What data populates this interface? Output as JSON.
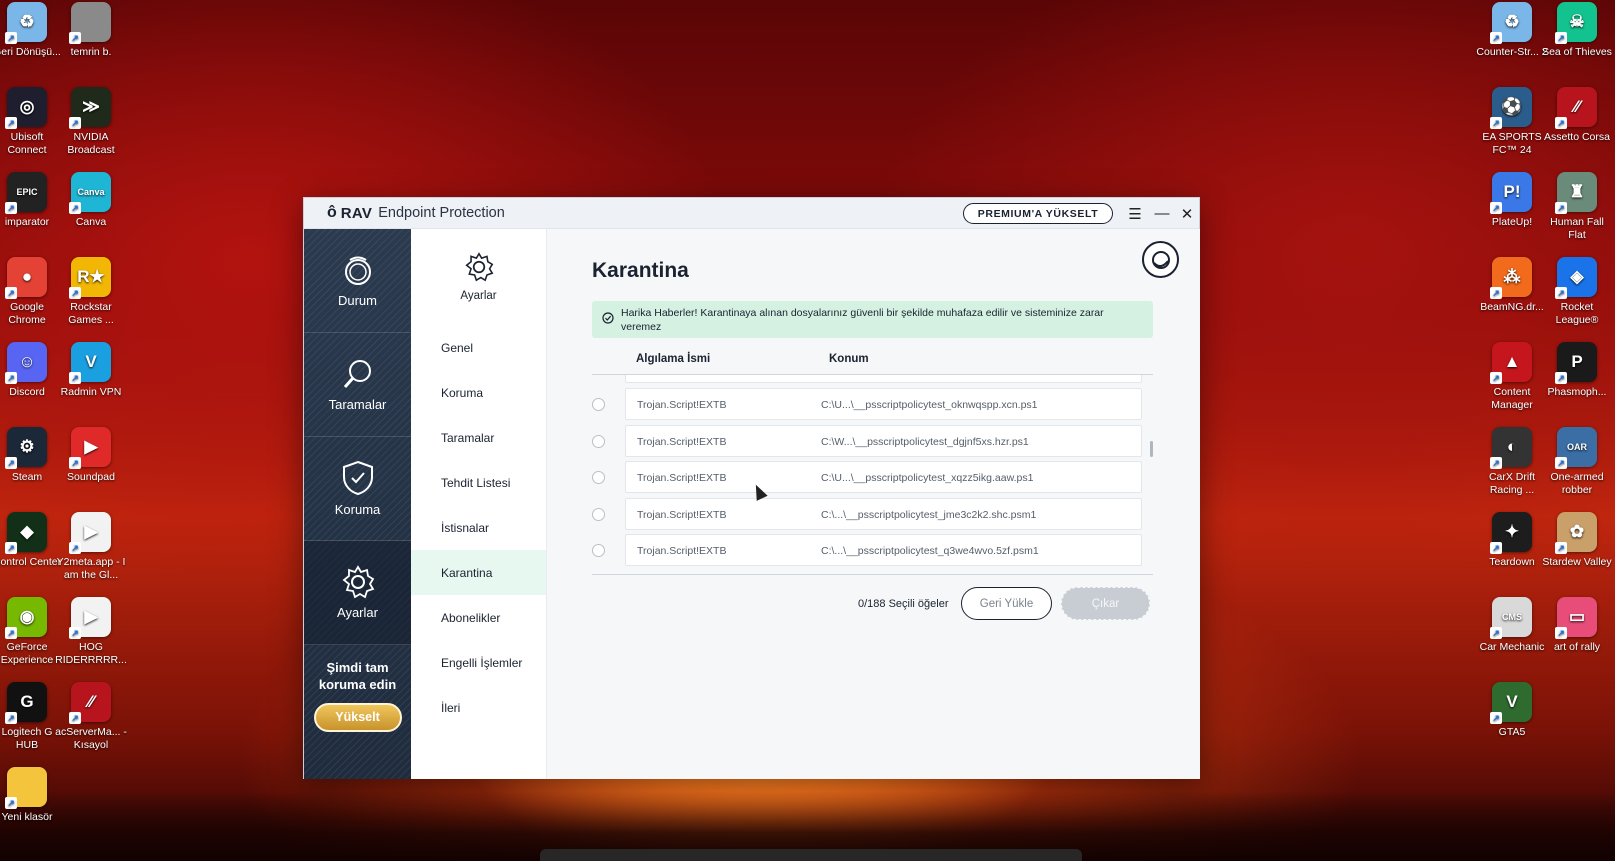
{
  "desktop": {
    "left_icons": [
      {
        "label": "Geri Dönüşü...",
        "icon": "recycle-bin-icon",
        "color": "#7bb6e8",
        "glyph": "♻"
      },
      {
        "label": "temrin b.",
        "icon": "file-icon",
        "color": "#8a8a8a",
        "glyph": ""
      },
      {
        "label": "Ubisoft Connect",
        "icon": "ubisoft-icon",
        "color": "#1e1e2e",
        "glyph": "◎"
      },
      {
        "label": "NVIDIA Broadcast",
        "icon": "nvidia-broadcast-icon",
        "color": "#1f2a1a",
        "glyph": "≫"
      },
      {
        "label": "imparator",
        "icon": "epic-games-icon",
        "color": "#222222",
        "glyph": "EPIC"
      },
      {
        "label": "Canva",
        "icon": "canva-icon",
        "color": "#1fb6d6",
        "glyph": "Canva"
      },
      {
        "label": "Google Chrome",
        "icon": "chrome-icon",
        "color": "#e34234",
        "glyph": "●"
      },
      {
        "label": "Rockstar Games ...",
        "icon": "rockstar-icon",
        "color": "#f2b705",
        "glyph": "R★"
      },
      {
        "label": "Discord",
        "icon": "discord-icon",
        "color": "#5865f2",
        "glyph": "☺"
      },
      {
        "label": "Radmin VPN",
        "icon": "radmin-vpn-icon",
        "color": "#1aa0e0",
        "glyph": "V"
      },
      {
        "label": "Steam",
        "icon": "steam-icon",
        "color": "#1b2838",
        "glyph": "⚙"
      },
      {
        "label": "Soundpad",
        "icon": "soundpad-icon",
        "color": "#e02a2a",
        "glyph": "▶"
      },
      {
        "label": "Control Center",
        "icon": "control-center-icon",
        "color": "#123018",
        "glyph": "◆"
      },
      {
        "label": "Y2meta.app - I am the Gl...",
        "icon": "media-file-icon",
        "color": "#f2f2f2",
        "glyph": "▶"
      },
      {
        "label": "GeForce Experience",
        "icon": "geforce-icon",
        "color": "#76b900",
        "glyph": "◉"
      },
      {
        "label": "HOG RIDERRRRR...",
        "icon": "media-file-icon",
        "color": "#f2f2f2",
        "glyph": "▶"
      },
      {
        "label": "Logitech G HUB",
        "icon": "logitech-icon",
        "color": "#111111",
        "glyph": "G"
      },
      {
        "label": "acServerMa... - Kısayol",
        "icon": "assetto-server-icon",
        "color": "#b8141e",
        "glyph": "⁄⁄"
      },
      {
        "label": "Yeni klasör",
        "icon": "folder-icon",
        "color": "#f4c43c",
        "glyph": ""
      }
    ],
    "right_icons": [
      {
        "label": "Counter-Str... 2",
        "icon": "recycle-bin-icon",
        "color": "#7bb6e8",
        "glyph": "♻"
      },
      {
        "label": "Sea of Thieves",
        "icon": "sea-of-thieves-icon",
        "color": "#13c38f",
        "glyph": "☠"
      },
      {
        "label": "EA SPORTS FC™ 24",
        "icon": "ea-fc-icon",
        "color": "#2b5d8c",
        "glyph": "⚽"
      },
      {
        "label": "Assetto Corsa",
        "icon": "assetto-corsa-icon",
        "color": "#b8141e",
        "glyph": "⁄⁄"
      },
      {
        "label": "PlateUp!",
        "icon": "plateup-icon",
        "color": "#3b78e7",
        "glyph": "P!"
      },
      {
        "label": "Human Fall Flat",
        "icon": "human-fall-flat-icon",
        "color": "#6a8a7a",
        "glyph": "♜"
      },
      {
        "label": "BeamNG.dr...",
        "icon": "beamng-icon",
        "color": "#f26a1b",
        "glyph": "⁂"
      },
      {
        "label": "Rocket League®",
        "icon": "rocket-league-icon",
        "color": "#1a73e8",
        "glyph": "◈"
      },
      {
        "label": "Content Manager",
        "icon": "content-manager-icon",
        "color": "#c4161c",
        "glyph": "▲"
      },
      {
        "label": "Phasmoph...",
        "icon": "phasmophobia-icon",
        "color": "#1a1a1a",
        "glyph": "P"
      },
      {
        "label": "CarX Drift Racing ...",
        "icon": "carx-icon",
        "color": "#333333",
        "glyph": "◐"
      },
      {
        "label": "One-armed robber",
        "icon": "one-armed-robber-icon",
        "color": "#3a6ea5",
        "glyph": "OAR"
      },
      {
        "label": "Teardown",
        "icon": "teardown-icon",
        "color": "#1d1d1d",
        "glyph": "✦"
      },
      {
        "label": "Stardew Valley",
        "icon": "stardew-icon",
        "color": "#caa06a",
        "glyph": "✿"
      },
      {
        "label": "Car Mechanic",
        "icon": "car-mechanic-icon",
        "color": "#d9d9d9",
        "glyph": "CMS"
      },
      {
        "label": "art of rally",
        "icon": "art-of-rally-icon",
        "color": "#e84d7a",
        "glyph": "▭"
      },
      {
        "label": "GTA5",
        "icon": "gta5-icon",
        "color": "#2f6b2f",
        "glyph": "V"
      }
    ]
  },
  "window": {
    "brand": "RAV",
    "product": "Endpoint Protection",
    "premium_label": "PREMIUM'A YÜKSELT"
  },
  "sidebar": {
    "items": [
      {
        "label": "Durum",
        "icon": "status-icon"
      },
      {
        "label": "Taramalar",
        "icon": "search-icon"
      },
      {
        "label": "Koruma",
        "icon": "shield-icon"
      },
      {
        "label": "Ayarlar",
        "icon": "gear-icon"
      }
    ],
    "promo_text": "Şimdi tam koruma edin",
    "upgrade_label": "Yükselt"
  },
  "subnav": {
    "header": "Ayarlar",
    "items": [
      "Genel",
      "Koruma",
      "Taramalar",
      "Tehdit Listesi",
      "İstisnalar",
      "Karantina",
      "Abonelikler",
      "Engelli İşlemler",
      "İleri"
    ],
    "active": "Karantina"
  },
  "main": {
    "title": "Karantina",
    "banner": "Harika Haberler! Karantinaya alınan dosyalarınız güvenli bir şekilde muhafaza edilir ve sisteminize zarar veremez",
    "columns": {
      "name": "Algılama İsmi",
      "location": "Konum"
    },
    "rows": [
      {
        "name": "Trojan.Script!EXTB",
        "path": "C:\\U...\\__psscriptpolicytest_oknwqspp.xcn.ps1"
      },
      {
        "name": "Trojan.Script!EXTB",
        "path": "C:\\W...\\__psscriptpolicytest_dgjnf5xs.hzr.ps1"
      },
      {
        "name": "Trojan.Script!EXTB",
        "path": "C:\\U...\\__psscriptpolicytest_xqzz5ikg.aaw.ps1"
      },
      {
        "name": "Trojan.Script!EXTB",
        "path": "C:\\...\\__psscriptpolicytest_jme3c2k2.shc.psm1"
      },
      {
        "name": "Trojan.Script!EXTB",
        "path": "C:\\...\\__psscriptpolicytest_q3we4wvo.5zf.psm1"
      }
    ],
    "selected_count": "0/188 Seçili öğeler",
    "restore_label": "Geri Yükle",
    "remove_label": "Çıkar"
  }
}
